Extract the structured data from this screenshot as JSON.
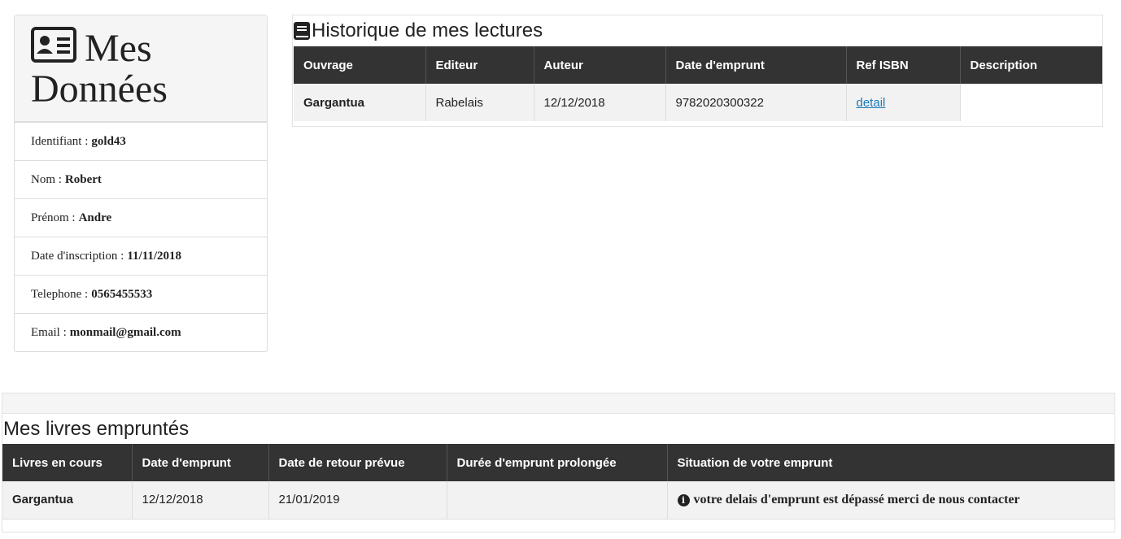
{
  "profile": {
    "title_line1": "Mes",
    "title_line2": "Données",
    "fields": [
      {
        "label": "Identifiant :",
        "value": "gold43"
      },
      {
        "label": "Nom :",
        "value": "Robert"
      },
      {
        "label": "Prénom :",
        "value": "Andre"
      },
      {
        "label": "Date d'inscription :",
        "value": "11/11/2018"
      },
      {
        "label": "Telephone :",
        "value": "0565455533"
      },
      {
        "label": "Email :",
        "value": "monmail@gmail.com"
      }
    ]
  },
  "history": {
    "title": "Historique de mes lectures",
    "headers": [
      "Ouvrage",
      "Editeur",
      "Auteur",
      "Date d'emprunt",
      "Ref ISBN",
      "Description"
    ],
    "rows": [
      {
        "ouvrage": "Gargantua",
        "editeur": "Rabelais",
        "auteur": "12/12/2018",
        "date": "9782020300322",
        "ref_link": "detail",
        "description": ""
      }
    ]
  },
  "borrowed": {
    "title": "Mes livres empruntés",
    "headers": [
      "Livres en cours",
      "Date d'emprunt",
      "Date de retour prévue",
      "Durée d'emprunt prolongée",
      "Situation de votre emprunt"
    ],
    "rows": [
      {
        "livre": "Gargantua",
        "date_emprunt": "12/12/2018",
        "date_retour": "21/01/2019",
        "duree": "",
        "situation": "votre delais d'emprunt est dépassé merci de nous contacter"
      }
    ]
  },
  "icons": {
    "profile": "id-card-icon",
    "history": "book-icon",
    "situation": "info-icon"
  }
}
